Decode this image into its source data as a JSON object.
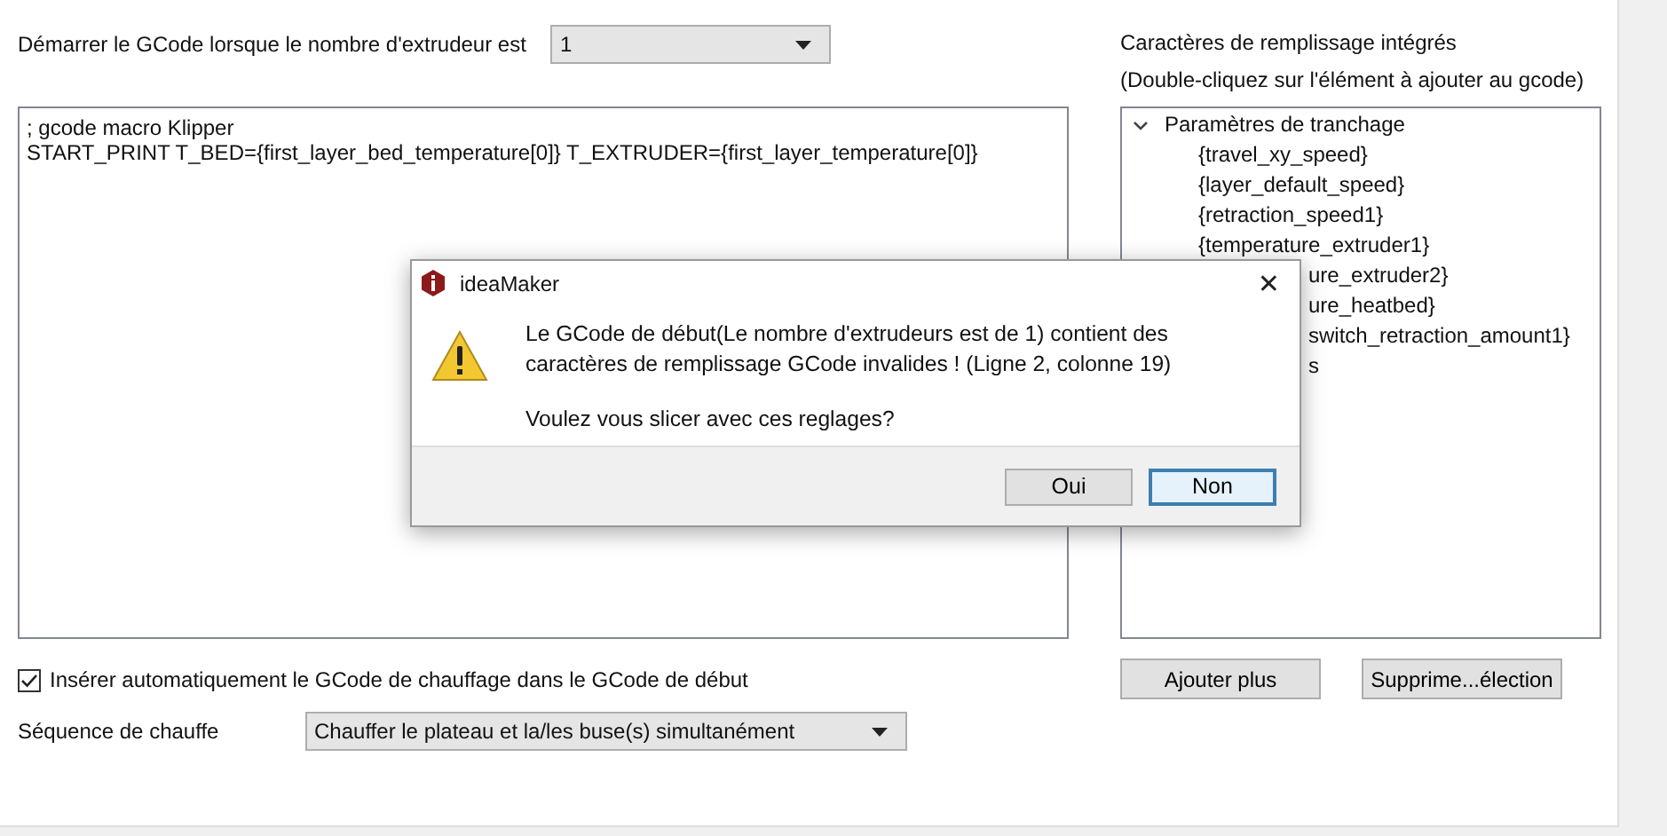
{
  "extruder_row": {
    "label": "Démarrer le GCode lorsque le nombre d'extrudeur est",
    "value": "1"
  },
  "gcode_editor": {
    "lines": [
      "; gcode macro Klipper",
      "START_PRINT T_BED={first_layer_bed_temperature[0]} T_EXTRUDER={first_layer_temperature[0]}"
    ]
  },
  "placeholders_panel": {
    "title": "Caractères de remplissage intégrés",
    "hint": "(Double-cliquez sur l'élément à ajouter au gcode)",
    "tree": [
      {
        "label": "Paramètres de tranchage",
        "expanded": true,
        "children": [
          {
            "label": "{travel_xy_speed}",
            "kind": "full"
          },
          {
            "label": "{layer_default_speed}",
            "kind": "full"
          },
          {
            "label": "{retraction_speed1}",
            "kind": "full"
          },
          {
            "label": "{temperature_extruder1}",
            "kind": "full"
          },
          {
            "label": "ure_extruder2}",
            "kind": "cut"
          },
          {
            "label": "ure_heatbed}",
            "kind": "cut"
          },
          {
            "label": "switch_retraction_amount1}",
            "kind": "cut"
          },
          {
            "label": "s",
            "kind": "cut"
          }
        ]
      }
    ]
  },
  "auto_heat": {
    "label": "Insérer automatiquement le GCode de chauffage dans le GCode de début",
    "checked": true
  },
  "panel_buttons": [
    "Ajouter plus",
    "Supprime...élection"
  ],
  "heat_sequence": {
    "label": "Séquence de chauffe",
    "value": "Chauffer le plateau et la/les buse(s) simultanément"
  },
  "dialog": {
    "title": "ideaMaker",
    "close": "✕",
    "message": "Le GCode de début(Le nombre d'extrudeurs est de 1) contient des caractères de remplissage GCode invalides ! (Ligne 2, colonne 19)",
    "question": "Voulez vous slicer avec ces reglages?",
    "buttons": [
      {
        "label": "Oui",
        "selected": false
      },
      {
        "label": "Non",
        "selected": true
      }
    ]
  }
}
